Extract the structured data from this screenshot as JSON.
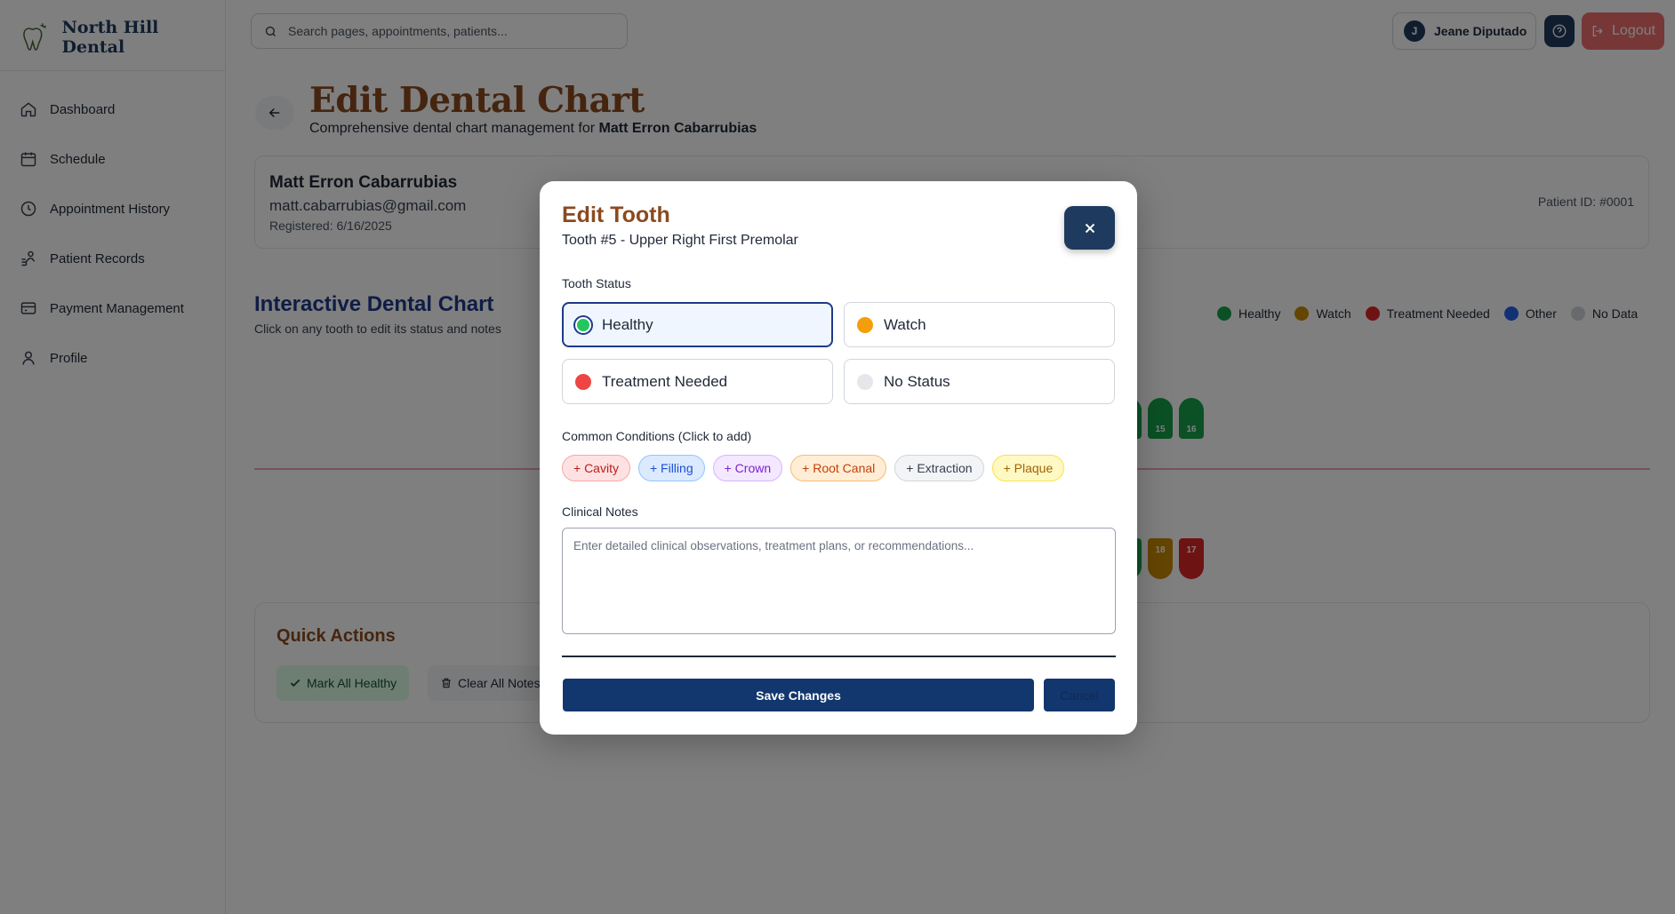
{
  "brand": {
    "name": "North Hill Dental",
    "logo_icon": "tooth-logo-icon"
  },
  "sidebar": {
    "items": [
      {
        "label": "Dashboard",
        "icon": "home-icon"
      },
      {
        "label": "Schedule",
        "icon": "calendar-icon"
      },
      {
        "label": "Appointment History",
        "icon": "clock-icon"
      },
      {
        "label": "Patient Records",
        "icon": "patient-records-icon"
      },
      {
        "label": "Payment Management",
        "icon": "credit-card-icon"
      },
      {
        "label": "Profile",
        "icon": "user-icon"
      }
    ]
  },
  "topbar": {
    "search_placeholder": "Search pages, appointments, patients...",
    "user_initial": "J",
    "user_name": "Jeane Diputado",
    "logout_label": "Logout"
  },
  "header": {
    "title": "Edit Dental Chart",
    "subtitle_prefix": "Comprehensive dental chart management for",
    "subtitle_patient": "Matt Erron Cabarrubias"
  },
  "patient": {
    "name": "Matt Erron Cabarrubias",
    "email": "matt.cabarrubias@gmail.com",
    "registered": "Registered: 6/16/2025",
    "patient_id": "Patient ID: #0001"
  },
  "chart": {
    "title": "Interactive Dental Chart",
    "subtitle": "Click on any tooth to edit its status and notes",
    "legend": [
      {
        "label": "Healthy",
        "color": "#16a34a"
      },
      {
        "label": "Watch",
        "color": "#ca8a04"
      },
      {
        "label": "Treatment Needed",
        "color": "#dc2626"
      },
      {
        "label": "Other",
        "color": "#2563eb"
      },
      {
        "label": "No Data",
        "color": "#d1d5db"
      }
    ],
    "visible_teeth": [
      {
        "number": "15",
        "status": "Healthy",
        "row": "upper"
      },
      {
        "number": "16",
        "status": "Healthy",
        "row": "upper"
      },
      {
        "number": "18",
        "status": "Watch",
        "row": "lower"
      },
      {
        "number": "17",
        "status": "Treatment Needed",
        "row": "lower"
      }
    ]
  },
  "quick_actions": {
    "title": "Quick Actions",
    "mark_all_healthy": "Mark All Healthy",
    "clear_all_notes": "Clear All Notes"
  },
  "modal": {
    "title": "Edit Tooth",
    "subtitle": "Tooth #5 - Upper Right First Premolar",
    "status_label": "Tooth Status",
    "statuses": [
      {
        "label": "Healthy",
        "color": "#22c55e",
        "selected": true
      },
      {
        "label": "Watch",
        "color": "#f59e0b",
        "selected": false
      },
      {
        "label": "Treatment Needed",
        "color": "#ef4444",
        "selected": false
      },
      {
        "label": "No Status",
        "color": "#e5e7eb",
        "selected": false
      }
    ],
    "conditions_label": "Common Conditions (Click to add)",
    "conditions": [
      {
        "label": "+ Cavity",
        "bg": "#fee2e2",
        "border": "#fca5a5",
        "text": "#b91c1c"
      },
      {
        "label": "+ Filling",
        "bg": "#dbeafe",
        "border": "#93c5fd",
        "text": "#1d4ed8"
      },
      {
        "label": "+ Crown",
        "bg": "#f3e8ff",
        "border": "#d8b4fe",
        "text": "#7e22ce"
      },
      {
        "label": "+ Root Canal",
        "bg": "#ffedd5",
        "border": "#fdba74",
        "text": "#c2410c"
      },
      {
        "label": "+ Extraction",
        "bg": "#f3f4f6",
        "border": "#d1d5db",
        "text": "#374151"
      },
      {
        "label": "+ Plaque",
        "bg": "#fef9c3",
        "border": "#fde047",
        "text": "#a16207"
      }
    ],
    "notes_label": "Clinical Notes",
    "notes_placeholder": "Enter detailed clinical observations, treatment plans, or recommendations...",
    "notes_value": "",
    "save_label": "Save Changes",
    "cancel_label": "Cancel"
  }
}
